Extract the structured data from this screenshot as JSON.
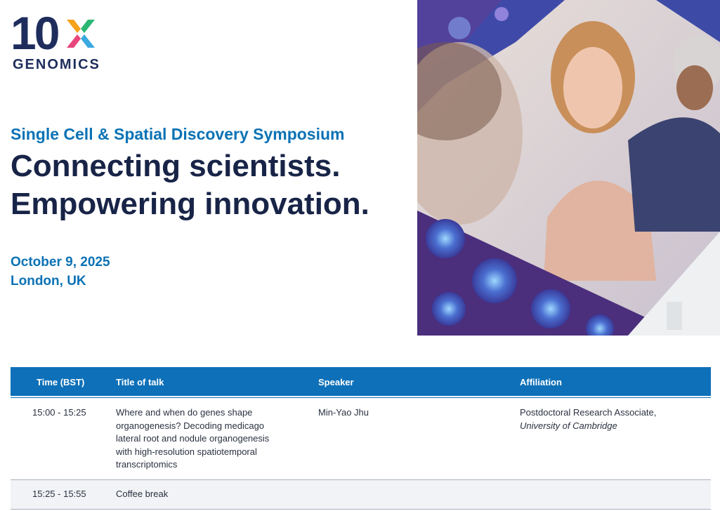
{
  "brand": {
    "wordmark": "10",
    "sub": "GENOMICS",
    "x_colors": [
      "#f4a31b",
      "#e8467c",
      "#2bb673",
      "#3aa9e0"
    ]
  },
  "event": {
    "name": "Single Cell & Spatial Discovery Symposium",
    "headline_1": "Connecting scientists.",
    "headline_2": "Empowering innovation.",
    "date": "October 9, 2025",
    "location": "London, UK"
  },
  "schedule": {
    "headers": {
      "time": "Time (BST)",
      "title": "Title of talk",
      "speaker": "Speaker",
      "affiliation": "Affiliation"
    },
    "rows": [
      {
        "time": "15:00 - 15:25",
        "title": [
          "Where and when do genes shape",
          "organogenesis? Decoding medicago",
          "lateral root and nodule organogenesis",
          "with high-resolution spatiotemporal",
          "transcriptomics"
        ],
        "speaker": "Min-Yao Jhu",
        "affiliation": "Postdoctoral Research Associate,",
        "institution": "University of Cambridge"
      },
      {
        "time": "15:25 - 15:55",
        "title": [
          "Coffee break"
        ],
        "speaker": "",
        "affiliation": "",
        "institution": ""
      }
    ]
  },
  "colors": {
    "brand_blue": "#0b72b5",
    "navy": "#182447",
    "header_bg": "#0e70b8"
  }
}
